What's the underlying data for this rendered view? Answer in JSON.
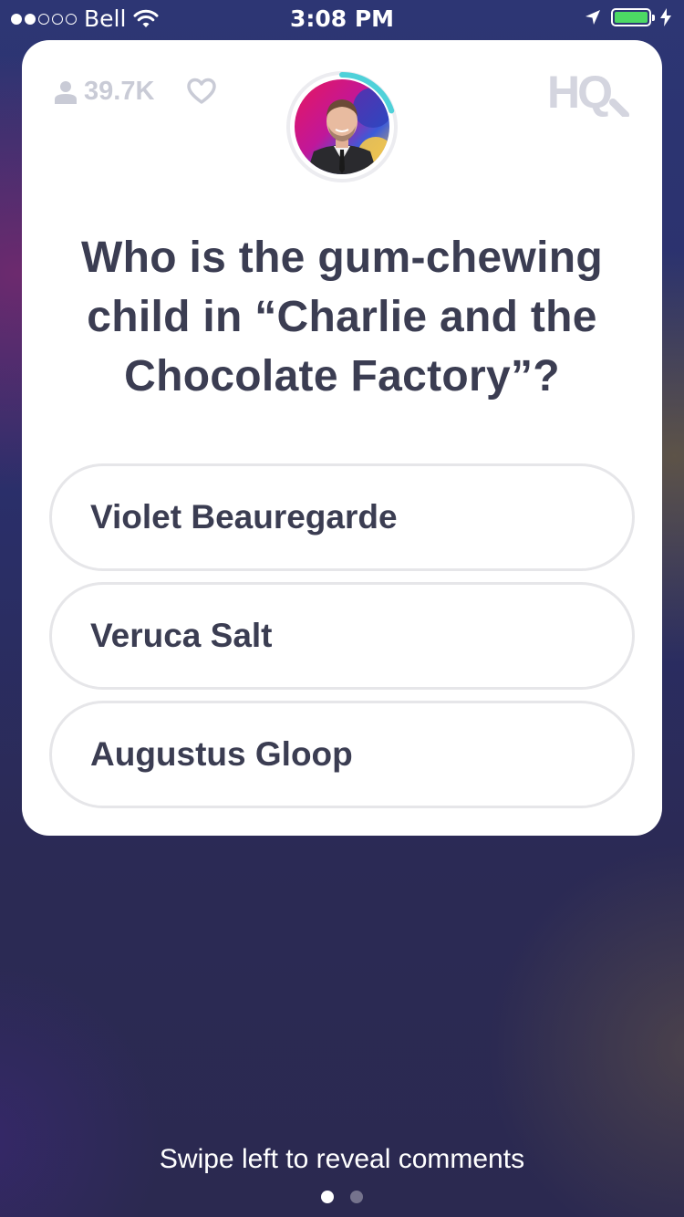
{
  "status_bar": {
    "carrier": "Bell",
    "time": "3:08 PM",
    "signal_bars_filled": 2,
    "signal_bars_total": 5,
    "battery_level": 1.0,
    "icons": [
      "wifi-icon",
      "location-arrow-icon",
      "battery-icon",
      "charging-bolt-icon"
    ]
  },
  "header": {
    "viewer_count": "39.7K",
    "logo": "HQ",
    "timer_progress": 0.2
  },
  "question": {
    "text": "Who is the gum-chewing child in “Charlie and the Chocolate Factory”?"
  },
  "answers": [
    {
      "label": "Violet Beauregarde"
    },
    {
      "label": "Veruca Salt"
    },
    {
      "label": "Augustus Gloop"
    }
  ],
  "footer": {
    "swipe_hint": "Swipe left to reveal comments",
    "page_count": 2,
    "current_page": 1
  },
  "colors": {
    "accent_timer": "#4fd1d9",
    "text_dark": "#3b3d52",
    "muted": "#c9cbd6",
    "battery": "#4cd964"
  }
}
